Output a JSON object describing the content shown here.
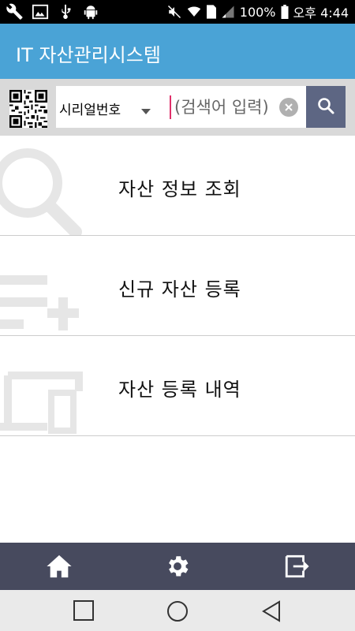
{
  "status_bar": {
    "battery": "100%",
    "ampm": "오후",
    "time": "4:44",
    "icons": [
      "wrench-icon",
      "image-icon",
      "usb-icon",
      "android-icon",
      "mute-icon",
      "wifi-icon",
      "sim-icon",
      "signal-icon",
      "battery-icon"
    ]
  },
  "app_bar": {
    "title": "IT 자산관리시스템",
    "color": "#4aa3d6"
  },
  "search": {
    "qr_icon": "qr-code-icon",
    "select_value": "시리얼번호",
    "placeholder": "(검색어 입력)",
    "clear_icon": "clear-icon",
    "button_icon": "search-icon",
    "button_color": "#5d6683"
  },
  "menu": {
    "items": [
      {
        "label": "자산 정보 조회",
        "icon": "magnifier-icon"
      },
      {
        "label": "신규 자산 등록",
        "icon": "add-list-icon"
      },
      {
        "label": "자산 등록 내역",
        "icon": "devices-icon"
      }
    ]
  },
  "bottom_nav": {
    "color": "#474a5e",
    "items": [
      "home-icon",
      "settings-icon",
      "logout-icon"
    ]
  },
  "system_nav": {
    "items": [
      "recent-apps-icon",
      "home-circle-icon",
      "back-icon"
    ]
  }
}
